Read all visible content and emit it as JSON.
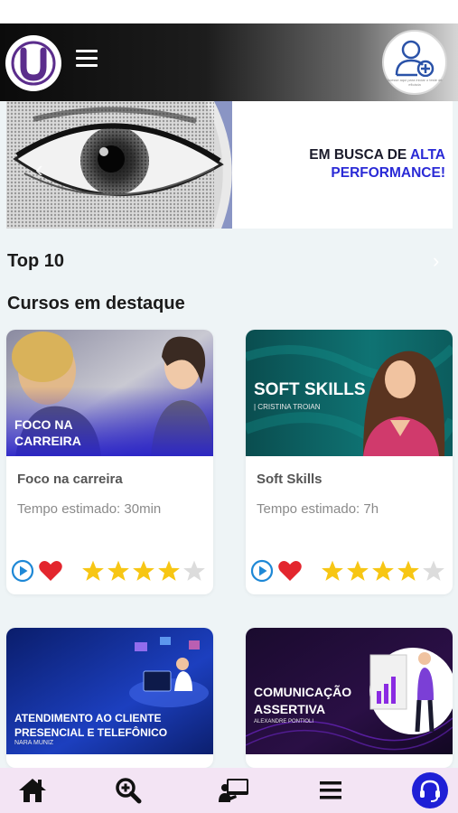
{
  "header": {
    "logo_letter": "U",
    "profile_caption": "Acesse aqui para iniciar o teste de eficácia"
  },
  "banner": {
    "line1_plain": "EM BUSCA DE ",
    "line1_accent": "ALTA",
    "line2_accent": "PERFORMANCE!"
  },
  "sections": {
    "top10": "Top 10",
    "featured": "Cursos em destaque"
  },
  "courses": [
    {
      "thumb_title_line1": "FOCO NA",
      "thumb_title_line2": "CARREIRA",
      "title": "Foco na carreira",
      "time": "Tempo estimado: 30min",
      "rating": 4,
      "rating_max": 5
    },
    {
      "thumb_title_line1": "SOFT SKILLS",
      "thumb_sub": "| CRISTINA TROIAN",
      "title": "Soft Skills",
      "time": "Tempo estimado: 7h",
      "rating": 4,
      "rating_max": 5
    },
    {
      "thumb_title_line1": "ATENDIMENTO AO CLIENTE",
      "thumb_title_line2": "PRESENCIAL E TELEFÔNICO",
      "thumb_sub": "NARA MUNIZ"
    },
    {
      "thumb_title_line1": "COMUNICAÇÃO",
      "thumb_title_line2": "ASSERTIVA",
      "thumb_sub": "ALEXANDRE PONTIOLI"
    }
  ],
  "colors": {
    "accent_blue": "#2a2ad6",
    "logo_purple": "#5b2d8c",
    "star_gold": "#f7c614",
    "heart_red": "#e3262e",
    "play_blue": "#1e88d6",
    "nav_bg": "#f3e4f4"
  },
  "icons": {
    "nav": [
      "home-icon",
      "zoom-in-icon",
      "presentation-icon",
      "menu-icon",
      "headset-icon"
    ]
  }
}
